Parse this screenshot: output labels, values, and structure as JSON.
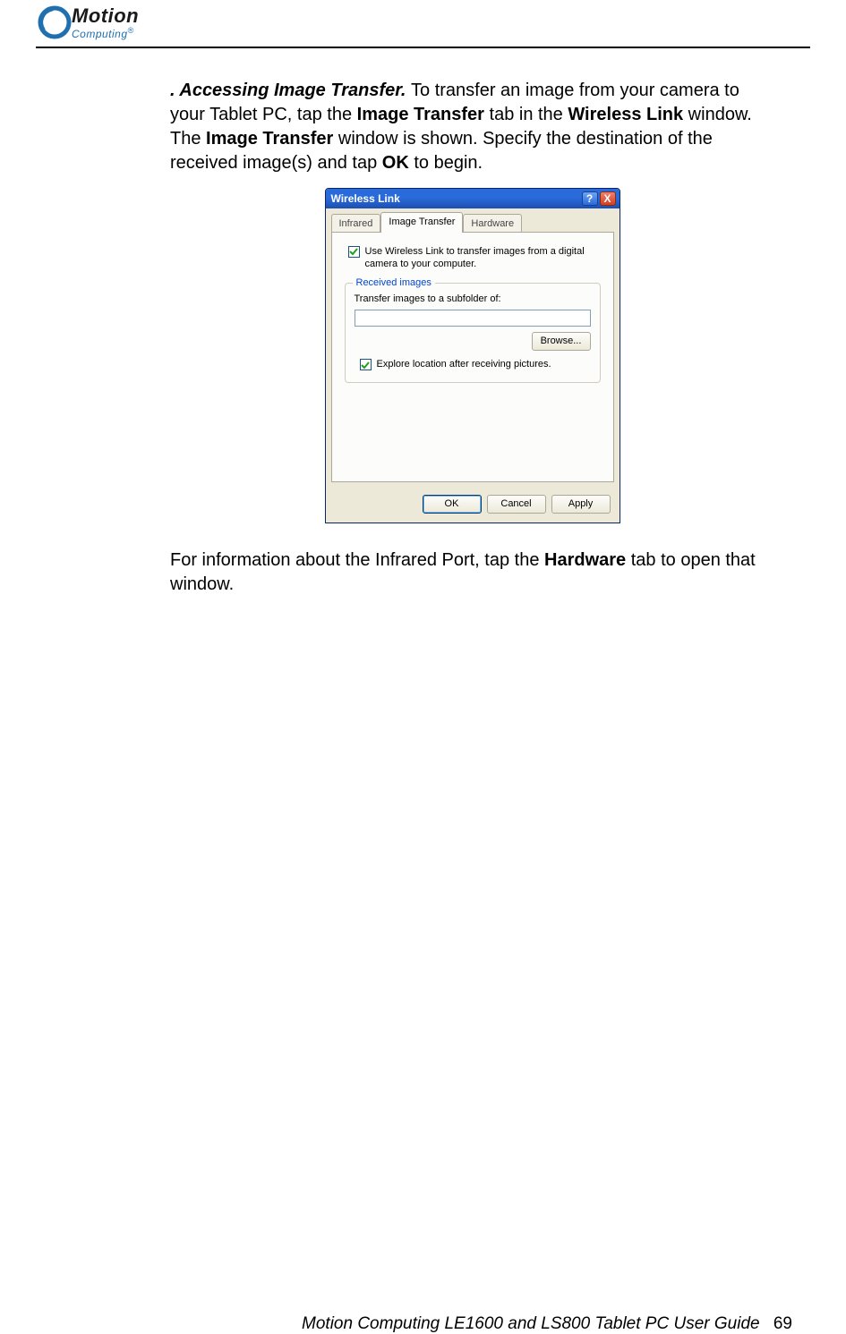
{
  "header": {
    "logo_main": "Motion",
    "logo_sub": "Computing",
    "logo_reg": "®"
  },
  "body": {
    "p1_lead": ". Accessing Image Transfer.  ",
    "p1_a": "To transfer an image from your camera to your Tablet PC, tap the ",
    "p1_b": "Image Transfer",
    "p1_c": " tab in the ",
    "p1_d": "Wireless Link",
    "p1_e": " window. The ",
    "p1_f": "Image Transfer",
    "p1_g": " window is shown. Specify the destination of the received image(s) and tap ",
    "p1_h": "OK",
    "p1_i": " to begin.",
    "p2_a": "For information about the Infrared Port, tap the ",
    "p2_b": "Hardware",
    "p2_c": " tab to open that window."
  },
  "dialog": {
    "title": "Wireless Link",
    "help": "?",
    "close": "X",
    "tabs": [
      "Infrared",
      "Image Transfer",
      "Hardware"
    ],
    "chk1": "Use Wireless Link to transfer images from a digital camera to your computer.",
    "legend": "Received images",
    "subfolder_label": "Transfer images to a subfolder of:",
    "path_value": "",
    "browse": "Browse...",
    "chk2": "Explore location after receiving pictures.",
    "ok": "OK",
    "cancel": "Cancel",
    "apply": "Apply"
  },
  "footer": {
    "text": "Motion Computing LE1600 and LS800 Tablet PC User Guide",
    "page": "69"
  }
}
